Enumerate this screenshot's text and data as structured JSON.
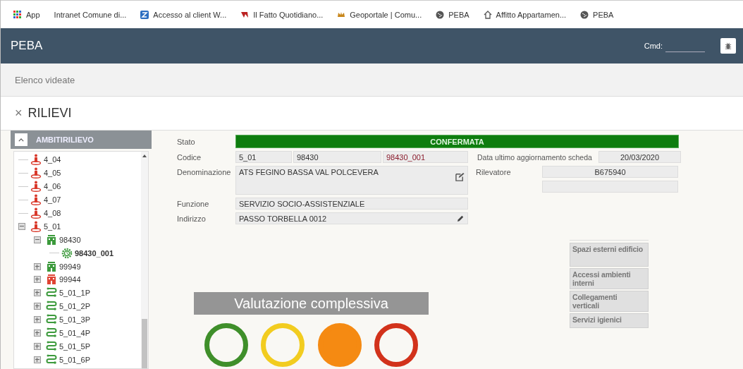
{
  "bookmarks": [
    {
      "label": "App",
      "kind": "apps"
    },
    {
      "label": "Intranet Comune di...",
      "kind": "none"
    },
    {
      "label": "Accesso al client W...",
      "kind": "zeta"
    },
    {
      "label": "Il Fatto Quotidiano...",
      "kind": "flag"
    },
    {
      "label": "Geoportale | Comu...",
      "kind": "crown"
    },
    {
      "label": "PEBA",
      "kind": "globe"
    },
    {
      "label": "Affitto Appartamen...",
      "kind": "house"
    },
    {
      "label": "PEBA",
      "kind": "globe"
    }
  ],
  "header": {
    "title": "PEBA",
    "cmd_label": "Cmd:"
  },
  "breadcrumb": "Elenco videate",
  "panel": {
    "close": "×",
    "title": "RILIEVI"
  },
  "tree": {
    "title": "AMBITIRILIEVO",
    "items": [
      {
        "label": "4_04",
        "kind": "person",
        "color": "#d9392b"
      },
      {
        "label": "4_05",
        "kind": "person",
        "color": "#d9392b"
      },
      {
        "label": "4_06",
        "kind": "person",
        "color": "#d9392b"
      },
      {
        "label": "4_07",
        "kind": "person",
        "color": "#d9392b"
      },
      {
        "label": "4_08",
        "kind": "person",
        "color": "#d9392b"
      },
      {
        "label": "5_01",
        "kind": "person",
        "color": "#d9392b",
        "expanded": true,
        "children": [
          {
            "label": "98430",
            "kind": "building",
            "color": "#3c9a3c",
            "expanded": true,
            "children": [
              {
                "label": "98430_001",
                "kind": "gear",
                "color": "#3c9a3c",
                "selected": true
              }
            ]
          },
          {
            "label": "99949",
            "kind": "building",
            "color": "#3c9a3c",
            "expanded": false
          },
          {
            "label": "99944",
            "kind": "building",
            "color": "#e04434",
            "expanded": false
          },
          {
            "label": "5_01_1P",
            "kind": "route",
            "color": "#3c9a3c",
            "expanded": false
          },
          {
            "label": "5_01_2P",
            "kind": "route",
            "color": "#3c9a3c",
            "expanded": false
          },
          {
            "label": "5_01_3P",
            "kind": "route",
            "color": "#3c9a3c",
            "expanded": false
          },
          {
            "label": "5_01_4P",
            "kind": "route",
            "color": "#3c9a3c",
            "expanded": false
          },
          {
            "label": "5_01_5P",
            "kind": "route",
            "color": "#3c9a3c",
            "expanded": false
          },
          {
            "label": "5_01_6P",
            "kind": "route",
            "color": "#3c9a3c",
            "expanded": false
          }
        ]
      }
    ]
  },
  "form": {
    "stato_label": "Stato",
    "stato": "CONFERMATA",
    "codice_label": "Codice",
    "codice": [
      "5_01",
      "98430",
      "98430_001"
    ],
    "data_label": "Data ultimo aggiornamento scheda",
    "data": "20/03/2020",
    "denominazione_label": "Denominazione",
    "denominazione": "ATS FEGINO BASSA VAL POLCEVERA",
    "rilevatore_label": "Rilevatore",
    "rilevatore": "B675940",
    "funzione_label": "Funzione",
    "funzione": "SERVIZIO SOCIO-ASSISTENZIALE",
    "indirizzo_label": "Indirizzo",
    "indirizzo": "PASSO TORBELLA 0012"
  },
  "sections": [
    "Spazi esterni edificio",
    "Accessi ambienti interni",
    "Collegamenti verticali",
    "Servizi igienici"
  ],
  "evaluation": {
    "title": "Valutazione complessiva",
    "ratings": [
      {
        "color": "#3f8f2a",
        "selected": false
      },
      {
        "color": "#f2cc1f",
        "selected": false
      },
      {
        "color": "#f58a12",
        "selected": true
      },
      {
        "color": "#d2321b",
        "selected": false
      }
    ]
  }
}
